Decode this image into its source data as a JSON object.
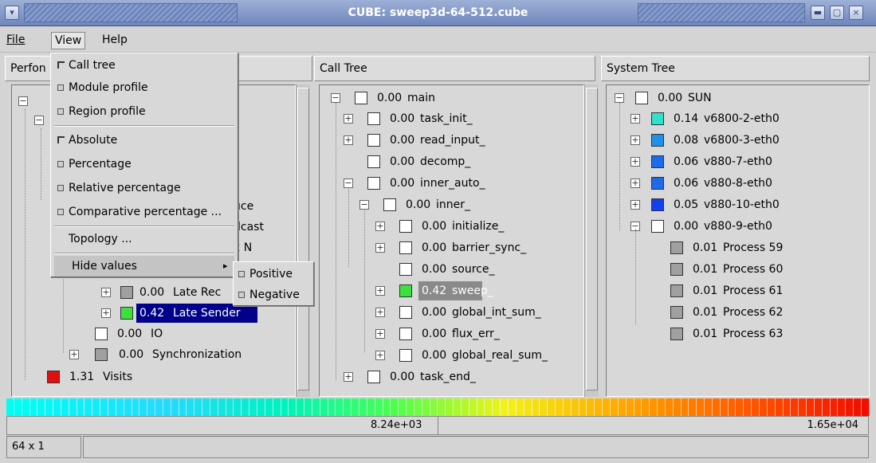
{
  "window": {
    "title": "CUBE:  sweep3d-64-512.cube"
  },
  "menubar": {
    "file": "File",
    "view": "View",
    "help": "Help"
  },
  "panels": {
    "performance": "Perfon",
    "call_tree": "Call Tree",
    "system_tree": "System Tree"
  },
  "view_menu": {
    "items": [
      "Call tree",
      "Module profile",
      "Region profile",
      "Absolute",
      "Percentage",
      "Relative percentage",
      "Comparative percentage ...",
      "Topology ...",
      "Hide values"
    ],
    "submenu": [
      "Positive",
      "Negative"
    ]
  },
  "metric_tree": {
    "fragments": [
      "uce",
      "dcast",
      "x N"
    ],
    "nodes": [
      {
        "value": "0.00",
        "name": "Late Rec",
        "color": "#a0a0a0"
      },
      {
        "value": "0.42",
        "name": "Late Sender",
        "color": "#3ee03e"
      },
      {
        "value": "0.00",
        "name": "IO",
        "color": "#ffffff"
      },
      {
        "value": "0.00",
        "name": "Synchronization",
        "color": "#a0a0a0"
      },
      {
        "value": "1.31",
        "name": "Visits",
        "color": "#e01010"
      }
    ]
  },
  "call_tree": {
    "nodes": [
      {
        "value": "0.00",
        "name": "main"
      },
      {
        "value": "0.00",
        "name": "task_init_"
      },
      {
        "value": "0.00",
        "name": "read_input_"
      },
      {
        "value": "0.00",
        "name": "decomp_"
      },
      {
        "value": "0.00",
        "name": "inner_auto_"
      },
      {
        "value": "0.00",
        "name": "inner_"
      },
      {
        "value": "0.00",
        "name": "initialize_"
      },
      {
        "value": "0.00",
        "name": "barrier_sync_"
      },
      {
        "value": "0.00",
        "name": "source_"
      },
      {
        "value": "0.42",
        "name": "sweep_"
      },
      {
        "value": "0.00",
        "name": "global_int_sum_"
      },
      {
        "value": "0.00",
        "name": "flux_err_"
      },
      {
        "value": "0.00",
        "name": "global_real_sum_"
      },
      {
        "value": "0.00",
        "name": "task_end_"
      }
    ]
  },
  "system_tree": {
    "nodes": [
      {
        "value": "0.00",
        "name": "SUN",
        "color": "#ffffff"
      },
      {
        "value": "0.14",
        "name": "v6800-2-eth0",
        "color": "#30e0c8"
      },
      {
        "value": "0.08",
        "name": "v6800-3-eth0",
        "color": "#2090e8"
      },
      {
        "value": "0.06",
        "name": "v880-7-eth0",
        "color": "#1f6ae8"
      },
      {
        "value": "0.06",
        "name": "v880-8-eth0",
        "color": "#1f6ae8"
      },
      {
        "value": "0.05",
        "name": "v880-10-eth0",
        "color": "#1040f0"
      },
      {
        "value": "0.00",
        "name": "v880-9-eth0",
        "color": "#ffffff"
      },
      {
        "value": "0.01",
        "name": "Process 59",
        "color": "#a0a0a0"
      },
      {
        "value": "0.01",
        "name": "Process 60",
        "color": "#a0a0a0"
      },
      {
        "value": "0.01",
        "name": "Process 61",
        "color": "#a0a0a0"
      },
      {
        "value": "0.01",
        "name": "Process 62",
        "color": "#a0a0a0"
      },
      {
        "value": "0.01",
        "name": "Process 63",
        "color": "#a0a0a0"
      }
    ]
  },
  "scale": {
    "mid": "8.24e+03",
    "max": "1.65e+04"
  },
  "status": {
    "left": "64 x 1"
  },
  "colors": {
    "selection": "#00008b",
    "sweep_highlight": "#8a8a8a"
  }
}
